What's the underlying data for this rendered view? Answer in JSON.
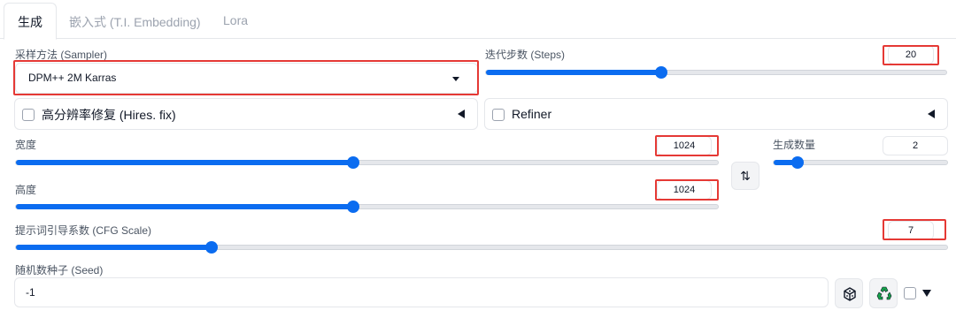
{
  "tabs": [
    {
      "label": "生成",
      "active": true
    },
    {
      "label": "嵌入式 (T.I. Embedding)",
      "active": false
    },
    {
      "label": "Lora",
      "active": false
    }
  ],
  "sampler": {
    "label": "采样方法 (Sampler)",
    "value": "DPM++ 2M Karras"
  },
  "steps": {
    "label": "迭代步数 (Steps)",
    "value": "20",
    "fraction": 0.38
  },
  "hires_fix": {
    "label": "高分辨率修复 (Hires. fix)",
    "checked": false
  },
  "refiner": {
    "label": "Refiner",
    "checked": false
  },
  "width": {
    "label": "宽度",
    "value": "1024",
    "fraction": 0.48
  },
  "height": {
    "label": "高度",
    "value": "1024",
    "fraction": 0.48
  },
  "batch_count": {
    "label": "生成数量",
    "value": "2",
    "fraction": 0.14
  },
  "swap_icon": "⇅",
  "cfg_scale": {
    "label": "提示词引导系数 (CFG Scale)",
    "value": "7",
    "fraction": 0.21
  },
  "seed": {
    "label": "随机数种子 (Seed)",
    "value": "-1"
  },
  "icons": [
    "dice-icon",
    "recycle-icon",
    "swap-dimensions-icon"
  ],
  "colors": {
    "accent": "#0b6cf0",
    "annotation_red": "#e53935",
    "recycle_green": "#16a34a"
  }
}
